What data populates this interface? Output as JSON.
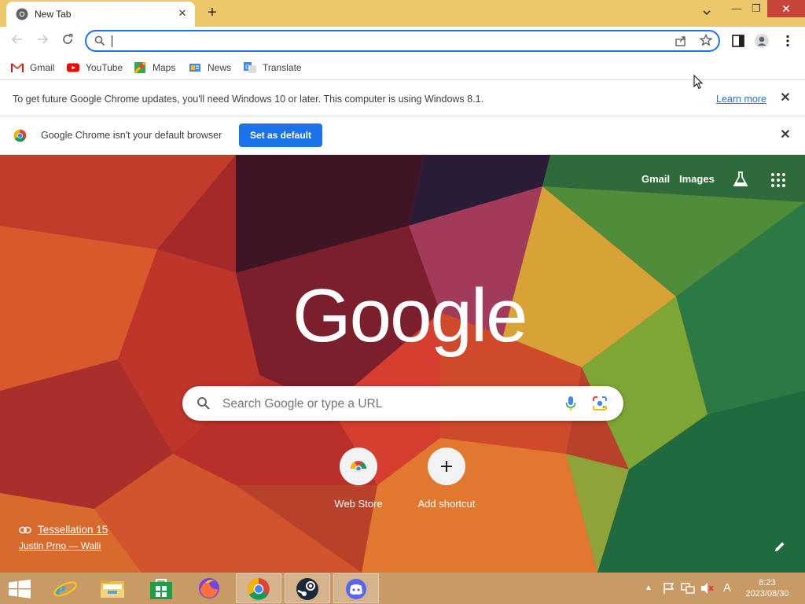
{
  "window": {
    "tab_title": "New Tab",
    "tab_close": "✕",
    "new_tab": "+",
    "minimize": "—",
    "maximize": "❐",
    "close": "✕"
  },
  "omnibox": {
    "value": ""
  },
  "bookmarks": [
    {
      "label": "Gmail"
    },
    {
      "label": "YouTube"
    },
    {
      "label": "Maps"
    },
    {
      "label": "News"
    },
    {
      "label": "Translate"
    }
  ],
  "infobar_update": {
    "text": "To get future Google Chrome updates, you'll need Windows 10 or later. This computer is using Windows 8.1.",
    "link": "Learn more",
    "close": "✕"
  },
  "infobar_default": {
    "text": "Google Chrome isn't your default browser",
    "button": "Set as default",
    "close": "✕"
  },
  "ntp": {
    "top_links": {
      "gmail": "Gmail",
      "images": "Images"
    },
    "logo": "Google",
    "search_placeholder": "Search Google or type a URL",
    "shortcuts": [
      {
        "label": "Web Store"
      },
      {
        "label": "Add shortcut"
      }
    ],
    "attribution_title": "Tessellation 15",
    "attribution_author": "Justin Prno — Walli"
  },
  "taskbar": {
    "time": "8:23",
    "date": "2023/08/30",
    "ime": "A"
  },
  "colors": {
    "titlebar": "#ecc86a",
    "accent": "#1a73e8",
    "close_button": "#c7453a",
    "taskbar": "#c79a66"
  }
}
